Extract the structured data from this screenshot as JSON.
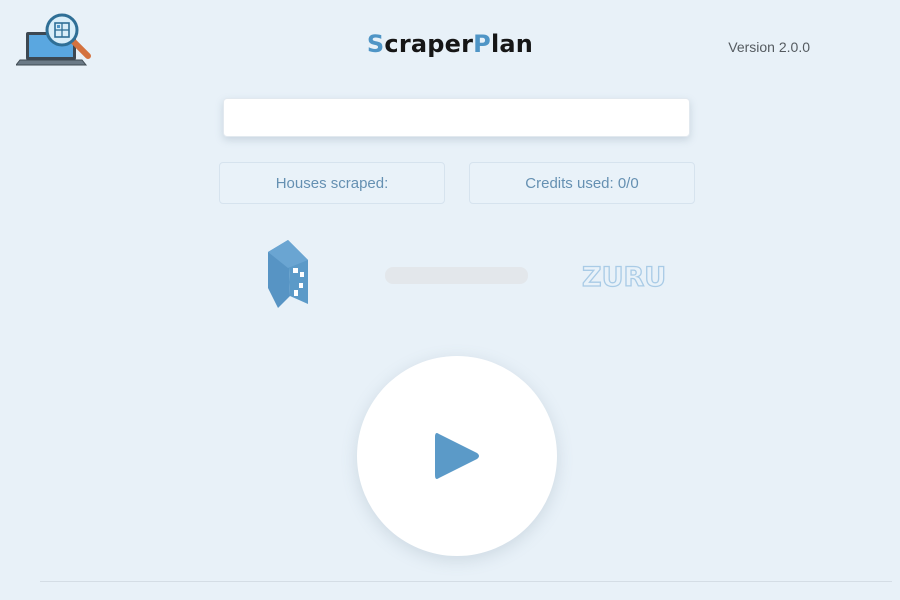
{
  "header": {
    "title_part1_accent": "S",
    "title_part1_rest": "craper",
    "title_part2_accent": "P",
    "title_part2_rest": "lan",
    "version": "Version 2.0.0"
  },
  "search": {
    "value": "",
    "placeholder": ""
  },
  "stats": {
    "houses_scraped": "Houses scraped:",
    "credits_used": "Credits used: 0/0"
  },
  "progress": {
    "percent": 0
  },
  "icons": {
    "logo": "laptop-magnifier-logo",
    "house": "house-block-icon",
    "brand": "zuru-logo",
    "play": "play-icon"
  },
  "brand": {
    "name": "ZURU"
  },
  "colors": {
    "background": "#e8f1f8",
    "accent": "#5b9ac8",
    "stat_text": "#6590b2"
  }
}
